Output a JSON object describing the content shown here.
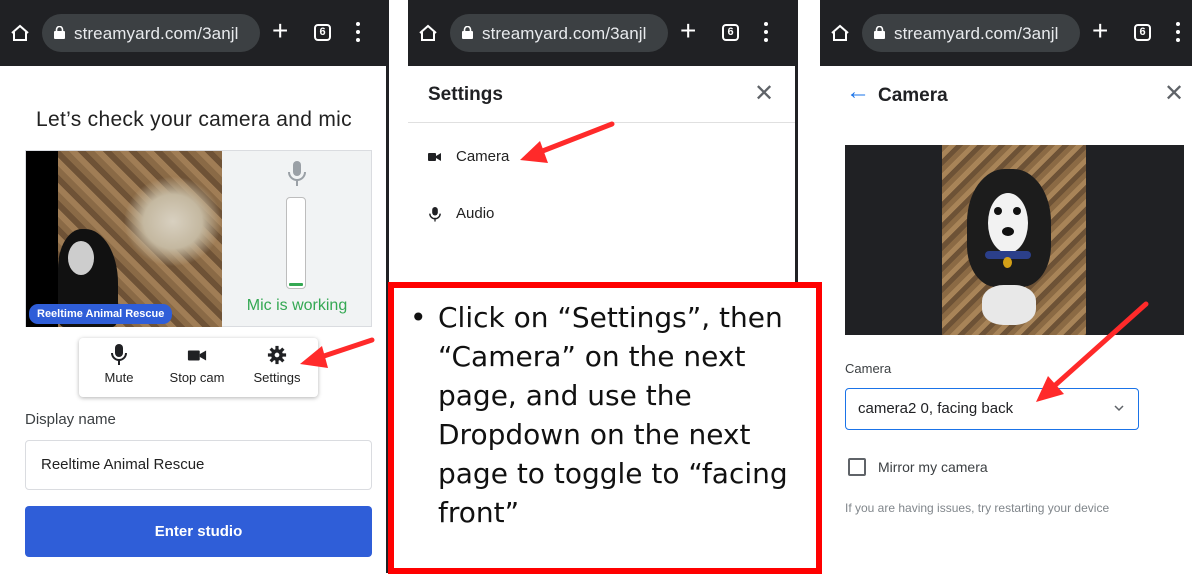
{
  "browser": {
    "url": "streamyard.com/3anjl",
    "tab_count": "6"
  },
  "panel1": {
    "title": "Let’s check your camera and mic",
    "name_badge": "Reeltime Animal Rescue",
    "mic_status": "Mic is working",
    "mic_level": 0.04,
    "controls": {
      "mute": "Mute",
      "stop_cam": "Stop cam",
      "settings": "Settings"
    },
    "display_name_label": "Display name",
    "display_name_value": "Reeltime Animal Rescue",
    "enter_button": "Enter studio"
  },
  "panel2": {
    "title": "Settings",
    "items": [
      {
        "label": "Camera",
        "icon": "video-camera-icon"
      },
      {
        "label": "Audio",
        "icon": "mic-icon"
      }
    ]
  },
  "callout": {
    "bullet": "•",
    "text": "Click on “Settings”, then “Camera” on the next page, and use the Dropdown on the next page to toggle to “facing front”"
  },
  "panel3": {
    "title": "Camera",
    "camera_label": "Camera",
    "camera_value": "camera2 0, facing back",
    "mirror_label": "Mirror my camera",
    "mirror_checked": false,
    "hint": "If you are having issues, try restarting your device"
  },
  "colors": {
    "accent": "#2f5ed8",
    "mic_green": "#34a853",
    "annotation_red": "#ff0000",
    "browser_bar": "#202124"
  }
}
